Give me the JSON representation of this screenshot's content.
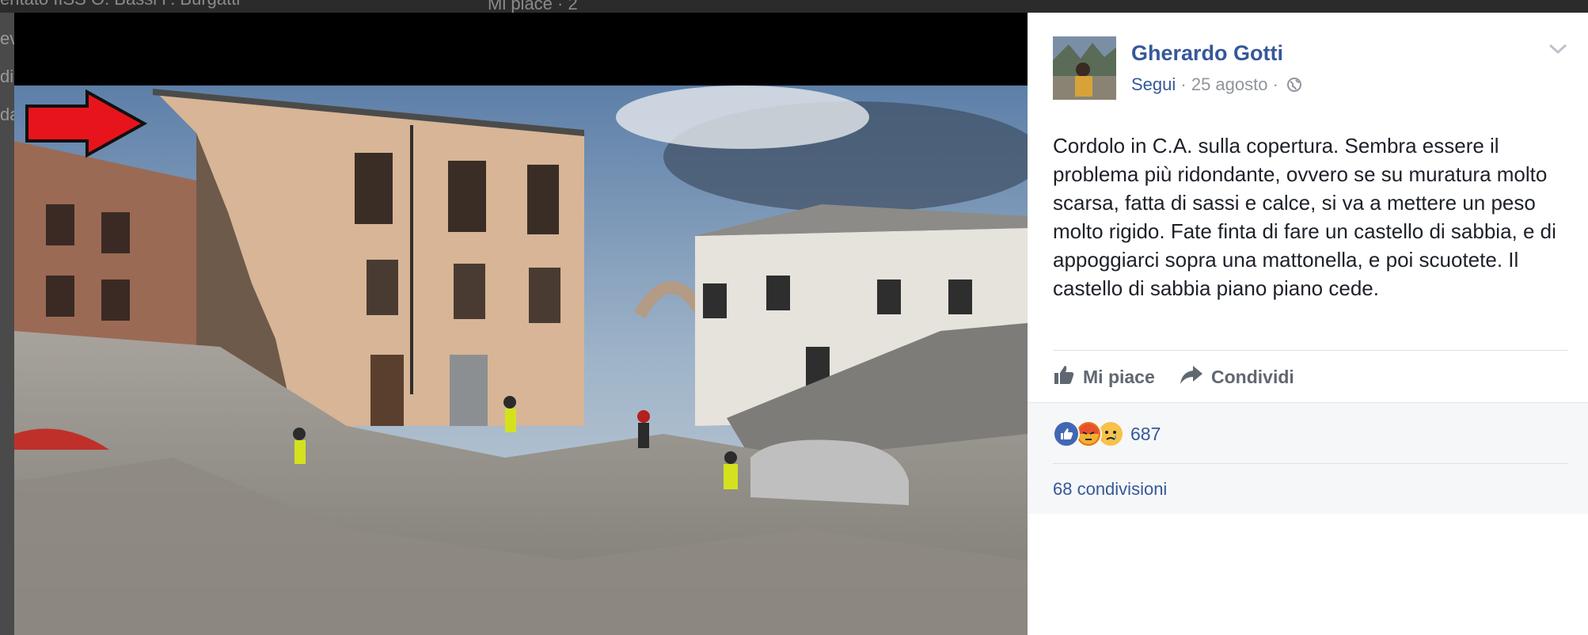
{
  "background": {
    "top_text": "Mi piace · 2 ",
    "side_text_1": "entato IISS O. Bassi F. Burgatti",
    "side_text_2": "ev",
    "side_text_3": "di",
    "side_text_4": "da"
  },
  "post": {
    "author": "Gherardo Gotti",
    "follow_label": "Segui",
    "date": "· 25 agosto ·",
    "privacy_icon": "globe-icon",
    "text": "Cordolo in C.A. sulla copertura. Sembra essere il problema più ridondante, ovvero se su muratura molto scarsa, fatta di sassi e calce, si va a mettere un peso molto rigido. Fate finta di fare un castello di sabbia, e di appoggiarci sopra una mattonella, e poi scuotete. Il castello di sabbia piano piano cede.",
    "actions": {
      "like_label": "Mi piace",
      "share_label": "Condividi"
    },
    "reactions": {
      "icons": [
        "like-icon",
        "angry-icon",
        "sad-icon"
      ],
      "count": "687"
    },
    "shares_label": "68 condivisioni"
  },
  "colors": {
    "link": "#365899",
    "accent_arrow": "#e8141c",
    "like_blue": "#4267b2"
  }
}
